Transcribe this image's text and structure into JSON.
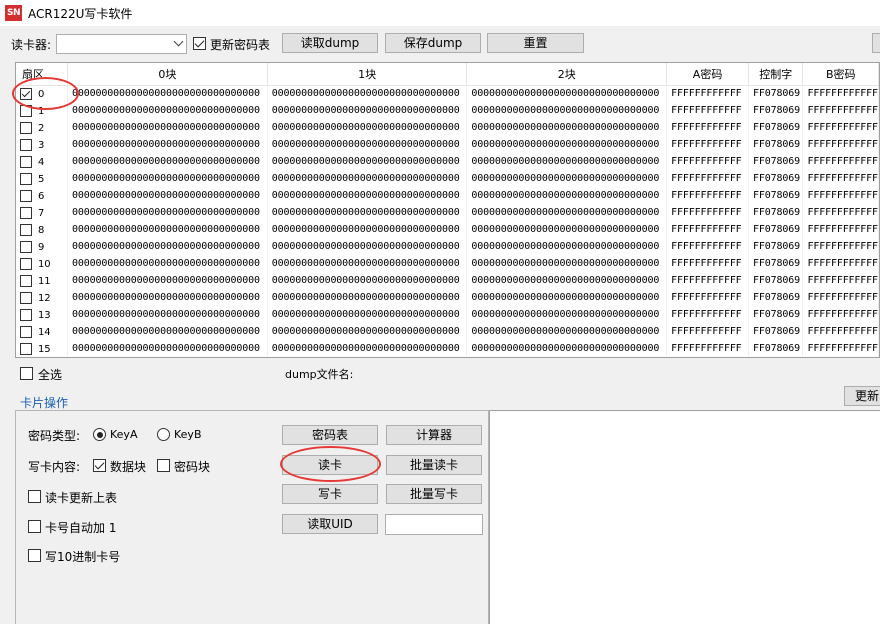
{
  "window": {
    "icon_text": "SN",
    "title": "ACR122U写卡软件"
  },
  "toolbar": {
    "reader_label": "读卡器:",
    "reader_value": "",
    "update_key_table_label": "更新密码表",
    "update_key_table_checked": true,
    "read_dump_button": "读取dump",
    "save_dump_button": "保存dump",
    "reset_button": "重置"
  },
  "grid": {
    "headers": [
      "扇区",
      "0块",
      "1块",
      "2块",
      "A密码",
      "控制字",
      "B密码"
    ],
    "rows": [
      {
        "sector": "0",
        "checked": true
      },
      {
        "sector": "1",
        "checked": false
      },
      {
        "sector": "2",
        "checked": false
      },
      {
        "sector": "3",
        "checked": false
      },
      {
        "sector": "4",
        "checked": false
      },
      {
        "sector": "5",
        "checked": false
      },
      {
        "sector": "6",
        "checked": false
      },
      {
        "sector": "7",
        "checked": false
      },
      {
        "sector": "8",
        "checked": false
      },
      {
        "sector": "9",
        "checked": false
      },
      {
        "sector": "10",
        "checked": false
      },
      {
        "sector": "11",
        "checked": false
      },
      {
        "sector": "12",
        "checked": false
      },
      {
        "sector": "13",
        "checked": false
      },
      {
        "sector": "14",
        "checked": false
      },
      {
        "sector": "15",
        "checked": false
      }
    ],
    "block_value": "00000000000000000000000000000000",
    "key_a_value": "FFFFFFFFFFFF",
    "access_bits_value": "FF078069",
    "key_b_value": "FFFFFFFFFFFF"
  },
  "below_grid": {
    "select_all_label": "全选",
    "dump_filename_label": "dump文件名:",
    "dump_filename_value": "",
    "update_button": "更新"
  },
  "card_ops": {
    "title": "卡片操作",
    "key_type_label": "密码类型:",
    "key_a_label": "KeyA",
    "key_b_label": "KeyB",
    "key_type_selected": "KeyA",
    "write_content_label": "写卡内容:",
    "data_block_label": "数据块",
    "data_block_checked": true,
    "key_block_label": "密码块",
    "key_block_checked": false,
    "read_update_table_label": "读卡更新上表",
    "auto_increment_label": "卡号自动加 1",
    "write_decimal_label": "写10进制卡号",
    "key_table_button": "密码表",
    "calculator_button": "计算器",
    "read_card_button": "读卡",
    "batch_read_button": "批量读卡",
    "write_card_button": "写卡",
    "batch_write_button": "批量写卡",
    "read_uid_button": "读取UID",
    "uid_value": ""
  },
  "colors": {
    "annotation": "#e53935",
    "group_title": "#1a5fb4"
  }
}
